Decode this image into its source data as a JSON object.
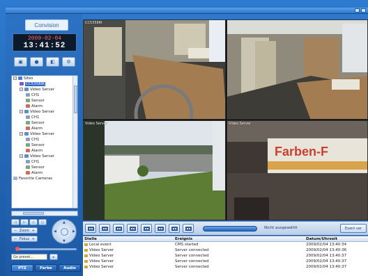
{
  "app": {
    "logo_text": "Convision",
    "clock_date": "2009-02-04",
    "clock_time": "13:41:52"
  },
  "toolbar_icons": [
    "camera-icon",
    "record-icon",
    "screenshot-icon",
    "settings-icon"
  ],
  "tree": {
    "items": [
      {
        "label": "Sites",
        "level": 0,
        "kind": "root"
      },
      {
        "label": "CC5358IR",
        "level": 1,
        "kind": "device",
        "selected": true
      },
      {
        "label": "Video Server",
        "level": 1,
        "kind": "server"
      },
      {
        "label": "CH1",
        "level": 2,
        "kind": "channel"
      },
      {
        "label": "Sensor",
        "level": 2,
        "kind": "sensor"
      },
      {
        "label": "Alarm",
        "level": 2,
        "kind": "alarm"
      },
      {
        "label": "Video Server",
        "level": 1,
        "kind": "server"
      },
      {
        "label": "CH1",
        "level": 2,
        "kind": "channel"
      },
      {
        "label": "Sensor",
        "level": 2,
        "kind": "sensor"
      },
      {
        "label": "Alarm",
        "level": 2,
        "kind": "alarm"
      },
      {
        "label": "Video Server",
        "level": 1,
        "kind": "server"
      },
      {
        "label": "CH1",
        "level": 2,
        "kind": "channel"
      },
      {
        "label": "Sensor",
        "level": 2,
        "kind": "sensor"
      },
      {
        "label": "Alarm",
        "level": 2,
        "kind": "alarm"
      },
      {
        "label": "Video Server",
        "level": 1,
        "kind": "server"
      },
      {
        "label": "CH1",
        "level": 2,
        "kind": "channel"
      },
      {
        "label": "Sensor",
        "level": 2,
        "kind": "sensor"
      },
      {
        "label": "Alarm",
        "level": 2,
        "kind": "alarm"
      },
      {
        "label": "Favorite Cameras",
        "level": 0,
        "kind": "favorites"
      }
    ]
  },
  "ptz": {
    "zoom_label": "Zoom",
    "focus_label": "Fokus",
    "preset_placeholder": "Go preset..."
  },
  "bottom_tabs": [
    "PTZ",
    "Farbe",
    "Audio"
  ],
  "video": {
    "cells": [
      {
        "label": "CC5358IR"
      },
      {
        "label": ""
      },
      {
        "label": "Video Server"
      },
      {
        "label": "Video Server"
      }
    ]
  },
  "status_text": "Nicht ausgewählt",
  "event_button": "Event ver",
  "events": {
    "columns": [
      "Stelle",
      "Ereignis",
      "Datum/Uhrzeit"
    ],
    "rows": [
      [
        "Local event",
        "CMS started",
        "2009/02/04  13:40:34"
      ],
      [
        "Video Server",
        "Server connected",
        "2009/02/04  13:40:36"
      ],
      [
        "Video Server",
        "Server connected",
        "2009/02/04  13:40:37"
      ],
      [
        "Video Server",
        "Server connected",
        "2009/02/04  13:40:37"
      ],
      [
        "Video Server",
        "Server connected",
        "2009/02/04  13:40:37"
      ]
    ]
  },
  "colors": {
    "accent": "#2d72c8",
    "clock_date": "#ff6b6b"
  }
}
